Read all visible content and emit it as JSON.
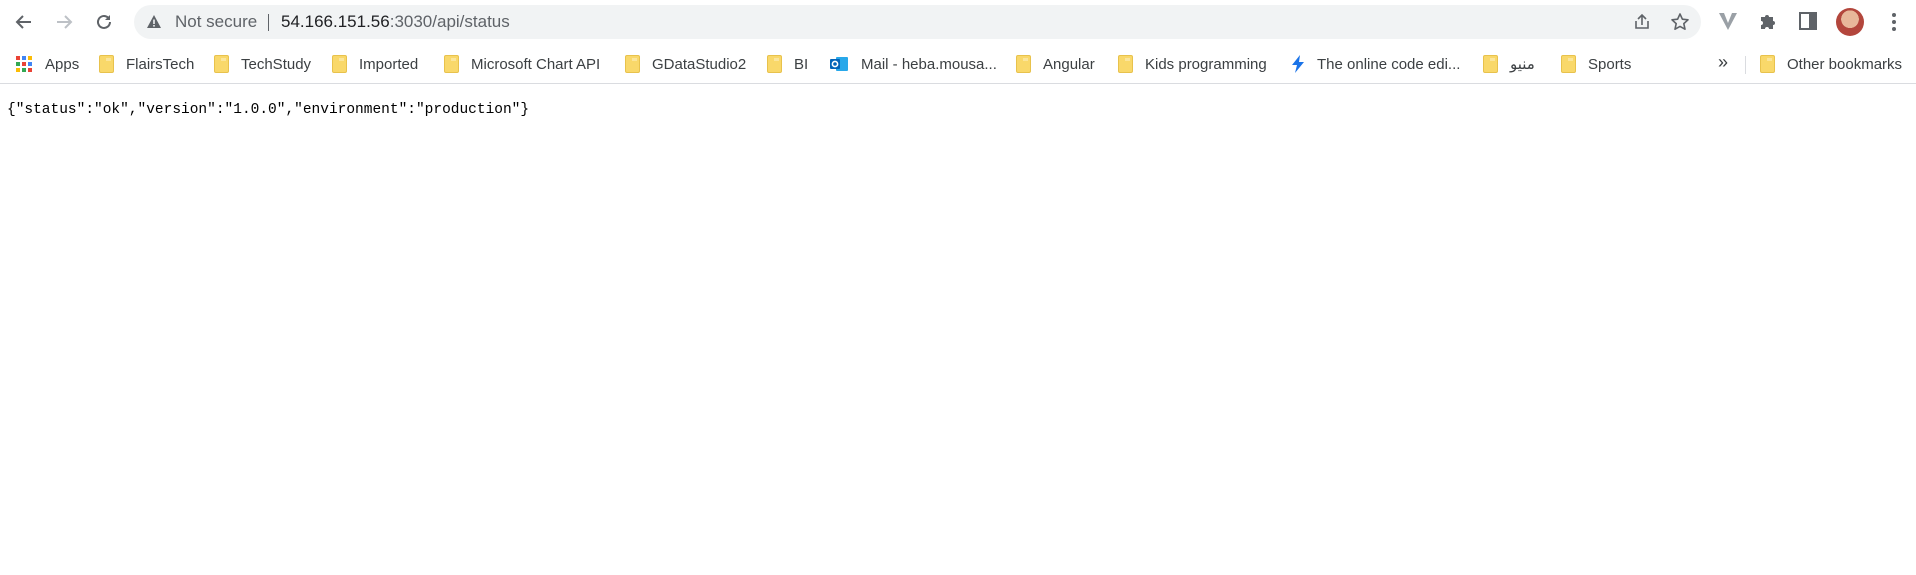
{
  "toolbar": {
    "back_icon": "arrow-left-icon",
    "forward_icon": "arrow-right-icon",
    "reload_icon": "reload-icon"
  },
  "omnibox": {
    "security_icon": "warning-triangle-icon",
    "security_label": "Not secure",
    "url_host": "54.166.151.56",
    "url_path": ":3030/api/status"
  },
  "bookmarks": {
    "items": [
      {
        "label": "Apps",
        "icon": "apps-grid-icon"
      },
      {
        "label": "FlairsTech",
        "icon": "folder-icon"
      },
      {
        "label": "TechStudy",
        "icon": "folder-icon"
      },
      {
        "label": "Imported",
        "icon": "folder-icon"
      },
      {
        "label": "Microsoft Chart API",
        "icon": "folder-icon"
      },
      {
        "label": "GDataStudio2",
        "icon": "folder-icon"
      },
      {
        "label": "BI",
        "icon": "folder-icon"
      },
      {
        "label": "Mail - heba.mousa...",
        "icon": "outlook-icon"
      },
      {
        "label": "Angular",
        "icon": "folder-icon"
      },
      {
        "label": "Kids programming",
        "icon": "folder-icon"
      },
      {
        "label": "The online code edi...",
        "icon": "bolt-icon"
      },
      {
        "label": "منيو",
        "icon": "folder-icon"
      },
      {
        "label": "Sports",
        "icon": "folder-icon"
      }
    ],
    "overflow_label": "»",
    "other_label": "Other bookmarks"
  },
  "page": {
    "body_text": "{\"status\":\"ok\",\"version\":\"1.0.0\",\"environment\":\"production\"}"
  },
  "colors": {
    "omnibox_bg": "#f1f3f4",
    "folder": "#f9d86a",
    "icon_gray": "#5f6368",
    "bolt": "#1a73e8"
  }
}
